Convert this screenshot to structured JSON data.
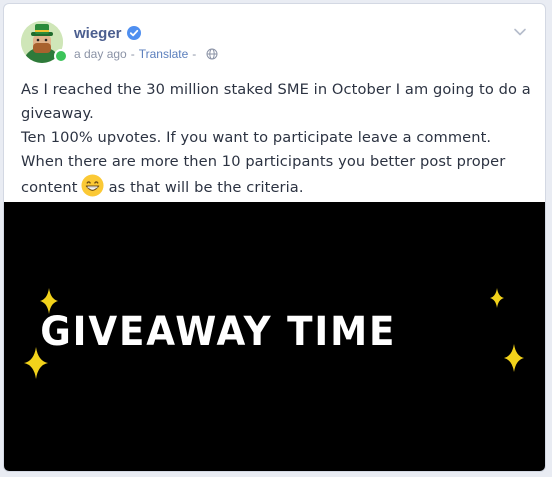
{
  "post": {
    "author": "wieger",
    "time": "a day ago",
    "sep1": "-",
    "translate_label": "Translate",
    "sep2": "-",
    "paragraphs": [
      "As I reached the 30 million staked SME in October I am going to do a giveaway.",
      "Ten 100% upvotes. If you want to participate leave a comment.",
      "When there are more then 10 participants you better post proper"
    ],
    "last_line_before_emoji": "content",
    "last_line_after_emoji": "as that will be the criteria."
  },
  "media": {
    "title": "GIVEAWAY TIME"
  },
  "icons": {
    "verified": "verified-badge-icon",
    "globe": "globe-icon",
    "chevron": "chevron-down-icon",
    "emoji": "grinning-face-emoji"
  },
  "colors": {
    "username": "#4b5e8f",
    "link": "#5b7fbd",
    "verified": "#4f8ff0",
    "online": "#3cc45a",
    "sparkle": "#f2d21b"
  }
}
